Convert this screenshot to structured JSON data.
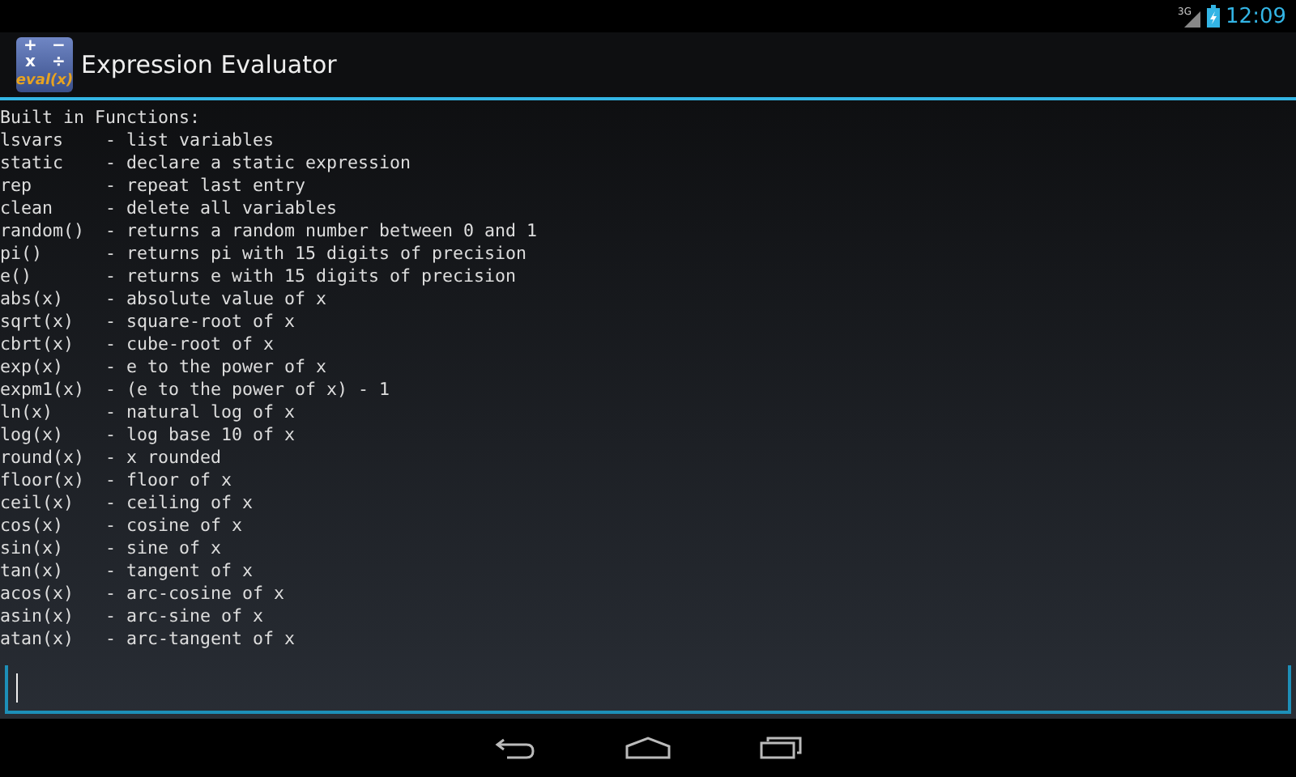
{
  "status_bar": {
    "network": "3G",
    "time": "12:09"
  },
  "action_bar": {
    "icon": {
      "symbols": [
        "+",
        "−",
        "x",
        "÷"
      ],
      "caption": "eval(x)"
    },
    "title": "Expression Evaluator"
  },
  "console": {
    "lines": [
      "Built in Functions:",
      "lsvars    - list variables",
      "static    - declare a static expression",
      "rep       - repeat last entry",
      "clean     - delete all variables",
      "random()  - returns a random number between 0 and 1",
      "pi()      - returns pi with 15 digits of precision",
      "e()       - returns e with 15 digits of precision",
      "abs(x)    - absolute value of x",
      "sqrt(x)   - square-root of x",
      "cbrt(x)   - cube-root of x",
      "exp(x)    - e to the power of x",
      "expm1(x)  - (e to the power of x) - 1",
      "ln(x)     - natural log of x",
      "log(x)    - log base 10 of x",
      "round(x)  - x rounded",
      "floor(x)  - floor of x",
      "ceil(x)   - ceiling of x",
      "cos(x)    - cosine of x",
      "sin(x)    - sine of x",
      "tan(x)    - tangent of x",
      "acos(x)   - arc-cosine of x",
      "asin(x)   - arc-sine of x",
      "atan(x)   - arc-tangent of x"
    ]
  }
}
